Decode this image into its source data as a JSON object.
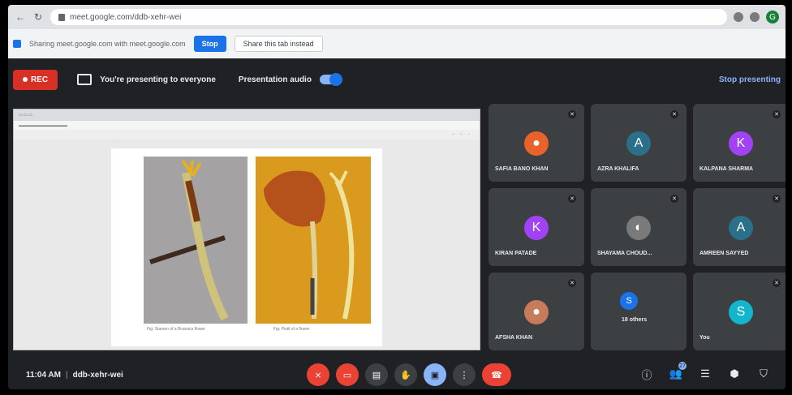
{
  "browser": {
    "url": "meet.google.com/ddb-xehr-wei",
    "profile_initial": "G"
  },
  "share_bar": {
    "message": "Sharing meet.google.com with meet.google.com",
    "stop_label": "Stop",
    "share_tab_label": "Share this tab instead"
  },
  "top_bar": {
    "rec_label": "REC",
    "presenting_text": "You're presenting to everyone",
    "audio_label": "Presentation audio",
    "stop_presenting_label": "Stop presenting"
  },
  "shared_screen": {
    "caption_left": "Fig: Stamen of a Brassica flower",
    "caption_right": "Fig: Pistil of a flower"
  },
  "participants": [
    {
      "name": "SAFIA BANO KHAN",
      "avatar_type": "image",
      "color": "#e8622a"
    },
    {
      "name": "AZRA KHALIFA",
      "avatar_type": "letter",
      "initial": "A",
      "color": "#2b6f8a"
    },
    {
      "name": "KALPANA SHARMA",
      "avatar_type": "letter",
      "initial": "K",
      "color": "#a142f4"
    },
    {
      "name": "KIRAN PATADE",
      "avatar_type": "letter",
      "initial": "K",
      "color": "#a142f4"
    },
    {
      "name": "SHAYAMA CHOUD...",
      "avatar_type": "image",
      "color": "#7a7a7a"
    },
    {
      "name": "AMREEN SAYYED",
      "avatar_type": "letter",
      "initial": "A",
      "color": "#2b6f8a"
    },
    {
      "name": "AFSHA KHAN",
      "avatar_type": "image",
      "color": "#c87b5a"
    },
    {
      "name": "18 others",
      "avatar_type": "group",
      "initial": "S",
      "color": "#1a73e8"
    },
    {
      "name": "You",
      "avatar_type": "letter",
      "initial": "S",
      "color": "#12b5cb"
    }
  ],
  "bottom_bar": {
    "time": "11:04 AM",
    "separator": "|",
    "meeting_code": "ddb-xehr-wei",
    "participants_count": "27"
  }
}
